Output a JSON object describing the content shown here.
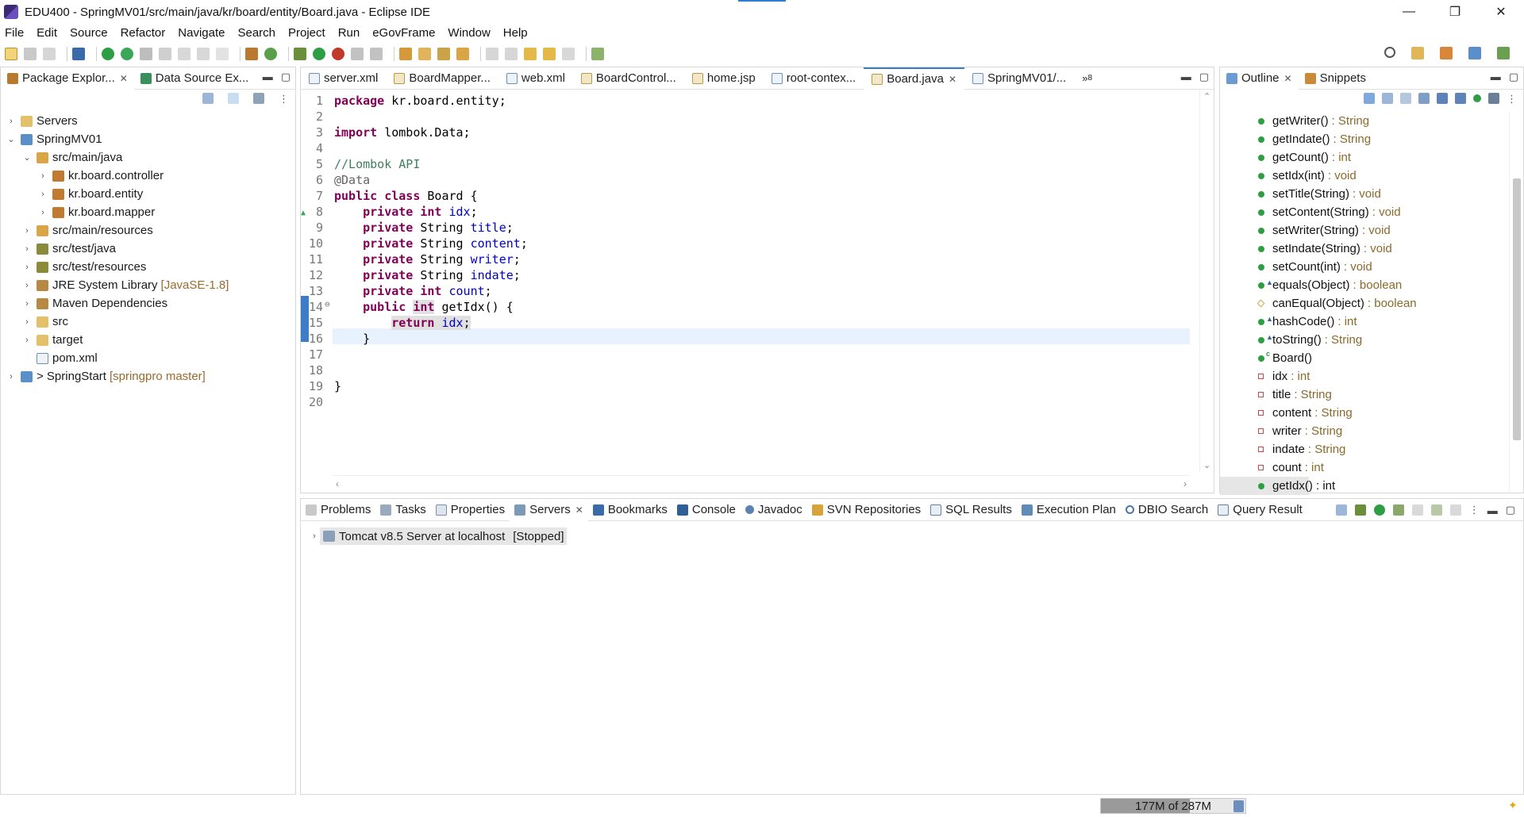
{
  "window": {
    "title": "EDU400 - SpringMV01/src/main/java/kr/board/entity/Board.java - Eclipse IDE",
    "minimize": "—",
    "maximize": "❐",
    "close": "✕"
  },
  "menu": [
    "File",
    "Edit",
    "Source",
    "Refactor",
    "Navigate",
    "Search",
    "Project",
    "Run",
    "eGovFrame",
    "Window",
    "Help"
  ],
  "left_panel": {
    "tabs": [
      {
        "label": "Package Explor...",
        "close": "✕"
      },
      {
        "label": "Data Source Ex..."
      }
    ],
    "tree": [
      {
        "label": "Servers",
        "twisty": "›",
        "indent": 0,
        "icon": "folder-icon"
      },
      {
        "label": "SpringMV01",
        "twisty": "⌄",
        "indent": 0,
        "icon": "project-icon"
      },
      {
        "label": "src/main/java",
        "twisty": "⌄",
        "indent": 1,
        "icon": "source-folder-icon"
      },
      {
        "label": "kr.board.controller",
        "twisty": "›",
        "indent": 2,
        "icon": "package-icon"
      },
      {
        "label": "kr.board.entity",
        "twisty": "›",
        "indent": 2,
        "icon": "package-icon"
      },
      {
        "label": "kr.board.mapper",
        "twisty": "›",
        "indent": 2,
        "icon": "package-icon"
      },
      {
        "label": "src/main/resources",
        "twisty": "›",
        "indent": 1,
        "icon": "source-folder-icon"
      },
      {
        "label": "src/test/java",
        "twisty": "›",
        "indent": 1,
        "icon": "source-folder-icon"
      },
      {
        "label": "src/test/resources",
        "twisty": "›",
        "indent": 1,
        "icon": "source-folder-icon"
      },
      {
        "label": "JRE System Library",
        "deco": "[JavaSE-1.8]",
        "twisty": "›",
        "indent": 1,
        "icon": "library-icon"
      },
      {
        "label": "Maven Dependencies",
        "twisty": "›",
        "indent": 1,
        "icon": "library-icon"
      },
      {
        "label": "src",
        "twisty": "›",
        "indent": 1,
        "icon": "folder-icon"
      },
      {
        "label": "target",
        "twisty": "›",
        "indent": 1,
        "icon": "folder-icon"
      },
      {
        "label": "pom.xml",
        "twisty": "",
        "indent": 1,
        "icon": "xml-file-icon"
      },
      {
        "label": "> SpringStart",
        "deco": "[springpro master]",
        "twisty": "›",
        "indent": 0,
        "icon": "project-icon"
      }
    ]
  },
  "editor": {
    "tabs": [
      {
        "label": "server.xml"
      },
      {
        "label": "BoardMapper..."
      },
      {
        "label": "web.xml"
      },
      {
        "label": "BoardControl..."
      },
      {
        "label": "home.jsp"
      },
      {
        "label": "root-contex..."
      },
      {
        "label": "Board.java",
        "active": true,
        "close": "✕"
      },
      {
        "label": "SpringMV01/..."
      }
    ],
    "overflow": "»",
    "overflow_count": "8",
    "lines": [
      "1",
      "2",
      "3",
      "4",
      "5",
      "6",
      "7",
      "8",
      "9",
      "10",
      "11",
      "12",
      "13",
      "14",
      "15",
      "16",
      "17",
      "18",
      "19",
      "20"
    ]
  },
  "outline": {
    "tabs": [
      {
        "label": "Outline",
        "close": "✕"
      },
      {
        "label": "Snippets"
      }
    ],
    "items": [
      {
        "name": "getWriter()",
        "type": ": String",
        "kind": "method"
      },
      {
        "name": "getIndate()",
        "type": ": String",
        "kind": "method"
      },
      {
        "name": "getCount()",
        "type": ": int",
        "kind": "method"
      },
      {
        "name": "setIdx(int)",
        "type": ": void",
        "kind": "method"
      },
      {
        "name": "setTitle(String)",
        "type": ": void",
        "kind": "method"
      },
      {
        "name": "setContent(String)",
        "type": ": void",
        "kind": "method"
      },
      {
        "name": "setWriter(String)",
        "type": ": void",
        "kind": "method"
      },
      {
        "name": "setIndate(String)",
        "type": ": void",
        "kind": "method"
      },
      {
        "name": "setCount(int)",
        "type": ": void",
        "kind": "method"
      },
      {
        "name": "equals(Object)",
        "type": ": boolean",
        "kind": "method-override"
      },
      {
        "name": "canEqual(Object)",
        "type": ": boolean",
        "kind": "method-protected"
      },
      {
        "name": "hashCode()",
        "type": ": int",
        "kind": "method-override"
      },
      {
        "name": "toString()",
        "type": ": String",
        "kind": "method-override"
      },
      {
        "name": "Board()",
        "type": "",
        "kind": "constructor"
      },
      {
        "name": "idx",
        "type": ": int",
        "kind": "field"
      },
      {
        "name": "title",
        "type": ": String",
        "kind": "field"
      },
      {
        "name": "content",
        "type": ": String",
        "kind": "field"
      },
      {
        "name": "writer",
        "type": ": String",
        "kind": "field"
      },
      {
        "name": "indate",
        "type": ": String",
        "kind": "field"
      },
      {
        "name": "count",
        "type": ": int",
        "kind": "field"
      },
      {
        "name": "getIdx() : int",
        "type": "",
        "kind": "method",
        "selected": true
      }
    ]
  },
  "bottom_panel": {
    "tabs": [
      {
        "label": "Problems"
      },
      {
        "label": "Tasks"
      },
      {
        "label": "Properties"
      },
      {
        "label": "Servers",
        "active": true,
        "close": "✕"
      },
      {
        "label": "Bookmarks"
      },
      {
        "label": "Console"
      },
      {
        "label": "Javadoc"
      },
      {
        "label": "SVN Repositories"
      },
      {
        "label": "SQL Results"
      },
      {
        "label": "Execution Plan"
      },
      {
        "label": "DBIO Search"
      },
      {
        "label": "Query Result"
      }
    ],
    "server": {
      "name": "Tomcat v8.5 Server at localhost",
      "state": "[Stopped]",
      "twisty": "›"
    }
  },
  "status": {
    "heap": "177M of 287M",
    "heap_fraction": 0.617
  },
  "colors": {
    "keyword": "#7f0055",
    "field": "#0000c0",
    "comment": "#3f7f5f",
    "method_public": "#2e9e44",
    "field_private": "#c24b4b",
    "type_deco": "#8a6a2b"
  }
}
